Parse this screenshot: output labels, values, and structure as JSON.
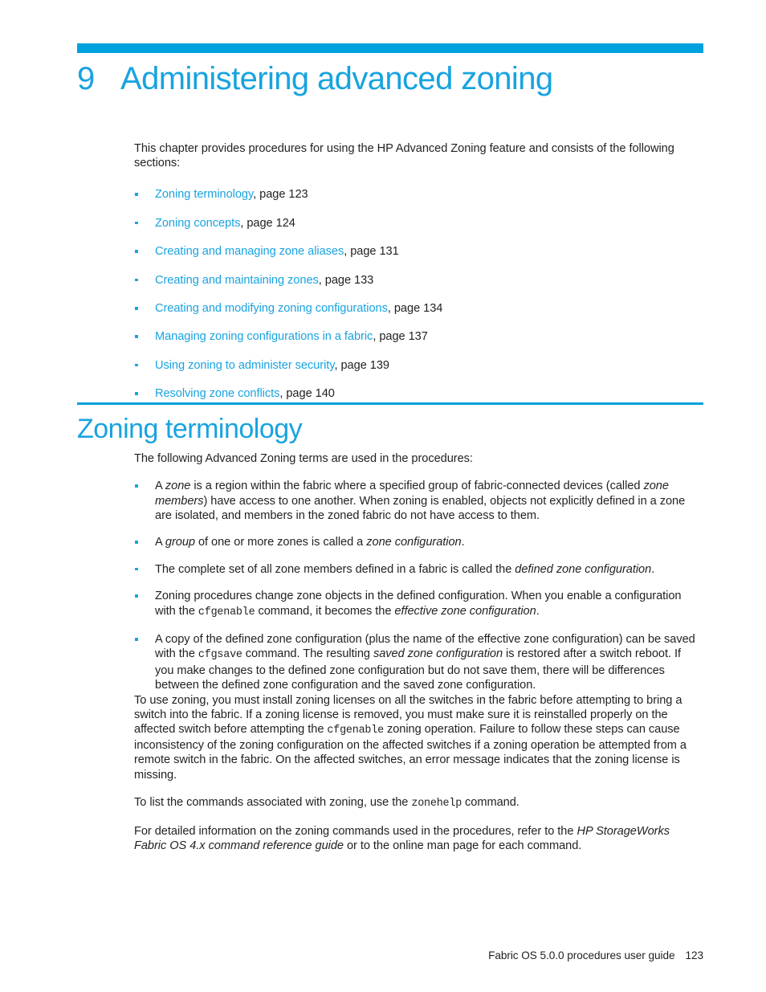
{
  "document": {
    "chapter_number": "9",
    "chapter_title": "Administering advanced zoning",
    "accent_color": "#18a3e0",
    "rule_color": "#00a1dd",
    "body_color": "#231f20"
  },
  "intro": {
    "text": "This chapter provides procedures for using the HP Advanced Zoning feature and consists of the following sections:"
  },
  "toc": {
    "items": [
      {
        "link": "Zoning terminology",
        "page": ", page 123"
      },
      {
        "link": "Zoning concepts",
        "page": ", page 124"
      },
      {
        "link": "Creating and managing zone aliases",
        "page": ", page 131"
      },
      {
        "link": "Creating and maintaining zones",
        "page": ", page 133"
      },
      {
        "link": "Creating and modifying zoning configurations",
        "page": ", page 134"
      },
      {
        "link": "Managing zoning configurations in a fabric",
        "page": ", page 137"
      },
      {
        "link": "Using zoning to administer security",
        "page": ", page 139"
      },
      {
        "link": "Resolving zone conflicts",
        "page": ", page 140"
      }
    ]
  },
  "section": {
    "heading": "Zoning terminology",
    "lead": "The following Advanced Zoning terms are used in the procedures:",
    "terms": [
      {
        "segments": [
          {
            "t": "A ",
            "style": "normal"
          },
          {
            "t": "zone",
            "style": "italic"
          },
          {
            "t": " is a region within the fabric where a specified group of fabric-connected devices (called ",
            "style": "normal"
          },
          {
            "t": "zone members",
            "style": "italic"
          },
          {
            "t": ") have access to one another. When zoning is enabled, objects not explicitly defined in a zone are isolated, and members in the zoned fabric do not have access to them.",
            "style": "normal"
          }
        ]
      },
      {
        "segments": [
          {
            "t": "A ",
            "style": "normal"
          },
          {
            "t": "group",
            "style": "italic"
          },
          {
            "t": " of one or more zones is called a ",
            "style": "normal"
          },
          {
            "t": "zone configuration",
            "style": "italic"
          },
          {
            "t": ".",
            "style": "normal"
          }
        ]
      },
      {
        "segments": [
          {
            "t": "The complete set of all zone members defined in a fabric is called the ",
            "style": "normal"
          },
          {
            "t": "defined zone configuration",
            "style": "italic"
          },
          {
            "t": ".",
            "style": "normal"
          }
        ]
      },
      {
        "segments": [
          {
            "t": "Zoning procedures change zone objects in the defined configuration. When you enable a configuration with the ",
            "style": "normal"
          },
          {
            "t": "cfgenable",
            "style": "code"
          },
          {
            "t": " command, it becomes the ",
            "style": "normal"
          },
          {
            "t": "effective zone configuration",
            "style": "italic"
          },
          {
            "t": ".",
            "style": "normal"
          }
        ]
      },
      {
        "segments": [
          {
            "t": "A copy of the defined zone configuration (plus the name of the effective zone configuration) can be saved with the ",
            "style": "normal"
          },
          {
            "t": "cfgsave",
            "style": "code"
          },
          {
            "t": " command. The resulting ",
            "style": "normal"
          },
          {
            "t": "saved zone configuration",
            "style": "italic"
          },
          {
            "t": " is restored after a switch reboot. If you make changes to the defined zone configuration but do not save them, there will be differences between the defined zone configuration and the saved zone configuration.",
            "style": "normal"
          }
        ]
      }
    ],
    "paragraphs": [
      {
        "segments": [
          {
            "t": "To use zoning, you must install zoning licenses on all the switches in the fabric before attempting to bring a switch into the fabric. If a zoning license is removed, you must make sure it is reinstalled properly on the affected switch before attempting the ",
            "style": "normal"
          },
          {
            "t": "cfgenable",
            "style": "code"
          },
          {
            "t": " zoning operation. Failure to follow these steps can cause inconsistency of the zoning configuration on the affected switches if a zoning operation be attempted from a remote switch in the fabric. On the affected switches, an error message indicates that the zoning license is missing.",
            "style": "normal"
          }
        ]
      },
      {
        "segments": [
          {
            "t": "To list the commands associated with zoning, use the ",
            "style": "normal"
          },
          {
            "t": "zonehelp",
            "style": "code"
          },
          {
            "t": " command.",
            "style": "normal"
          }
        ]
      },
      {
        "segments": [
          {
            "t": "For detailed information on the zoning commands used in the procedures, refer to the ",
            "style": "normal"
          },
          {
            "t": "HP StorageWorks Fabric OS 4.x command reference guide",
            "style": "italic"
          },
          {
            "t": " or to the online man page for each command.",
            "style": "normal"
          }
        ]
      }
    ]
  },
  "footer": {
    "guide_title": "Fabric OS 5.0.0 procedures user guide",
    "page_number": "123"
  }
}
